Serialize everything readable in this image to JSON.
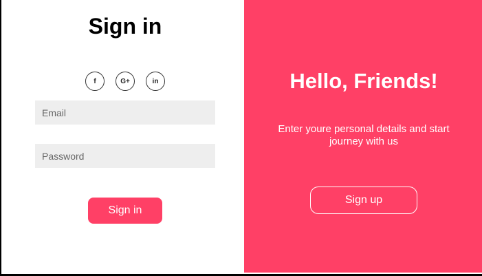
{
  "signin": {
    "title": "Sign in",
    "social": {
      "facebook": "f",
      "google": "G+",
      "linkedin": "in"
    },
    "email_placeholder": "Email",
    "password_placeholder": "Password",
    "button_label": "Sign in"
  },
  "welcome": {
    "title": "Hello, Friends!",
    "description": "Enter youre personal details and start journey with us",
    "button_label": "Sign up"
  },
  "colors": {
    "accent": "#ff4066",
    "field_bg": "#eeeeee",
    "text_dark": "#000000",
    "text_light": "#ffffff"
  }
}
